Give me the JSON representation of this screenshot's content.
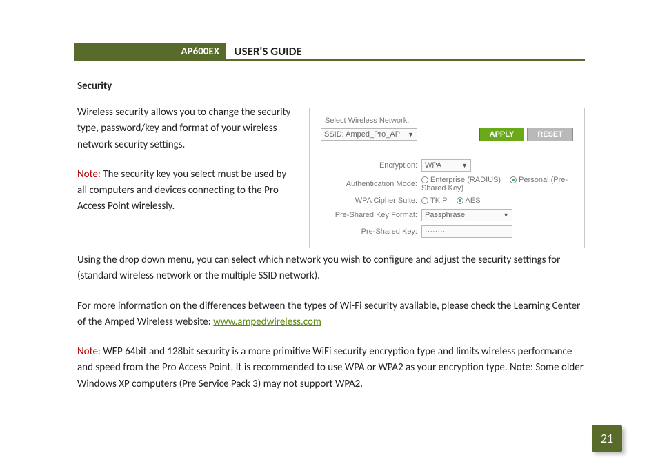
{
  "header": {
    "model": "AP600EX",
    "title": "USER'S GUIDE"
  },
  "section": {
    "heading": "Security",
    "para1": "Wireless security allows you to change the security type, password/key and format of your wireless network security settings.",
    "note1_label": "Note:",
    "note1_text": "  The security key you select must be used by all computers and devices connecting to the Pro Access Point wirelessly.",
    "para2a": "Using the drop down menu, you can select which network you wish to configure and adjust the security settings for (standard wireless network or the multiple SSID network).",
    "para3a": "For more information on the differences between the types of Wi-Fi security available, please check the Learning Center of the Amped Wireless website:  ",
    "link_text": "www.ampedwireless.com",
    "note2_label": "Note:",
    "note2_text": "  WEP 64bit and 128bit security is a more primitive WiFi security encryption type and limits wireless performance and speed from the Pro Access Point.  It is recommended to use WPA or WPA2 as your encryption type.  Note: Some older Windows XP computers (Pre Service Pack 3) may not support WPA2."
  },
  "panel": {
    "select_label": "Select Wireless Network:",
    "ssid_value": "SSID: Amped_Pro_AP",
    "apply": "APPLY",
    "reset": "RESET",
    "enc_label": "Encryption:",
    "enc_value": "WPA",
    "auth_label": "Authentication Mode:",
    "auth_opt1": "Enterprise (RADIUS)",
    "auth_opt2": "Personal (Pre-Shared Key)",
    "cipher_label": "WPA Cipher Suite:",
    "cipher_opt1": "TKIP",
    "cipher_opt2": "AES",
    "pskfmt_label": "Pre-Shared Key Format:",
    "pskfmt_value": "Passphrase",
    "psk_label": "Pre-Shared Key:",
    "psk_value": "········"
  },
  "pagenum": "21"
}
